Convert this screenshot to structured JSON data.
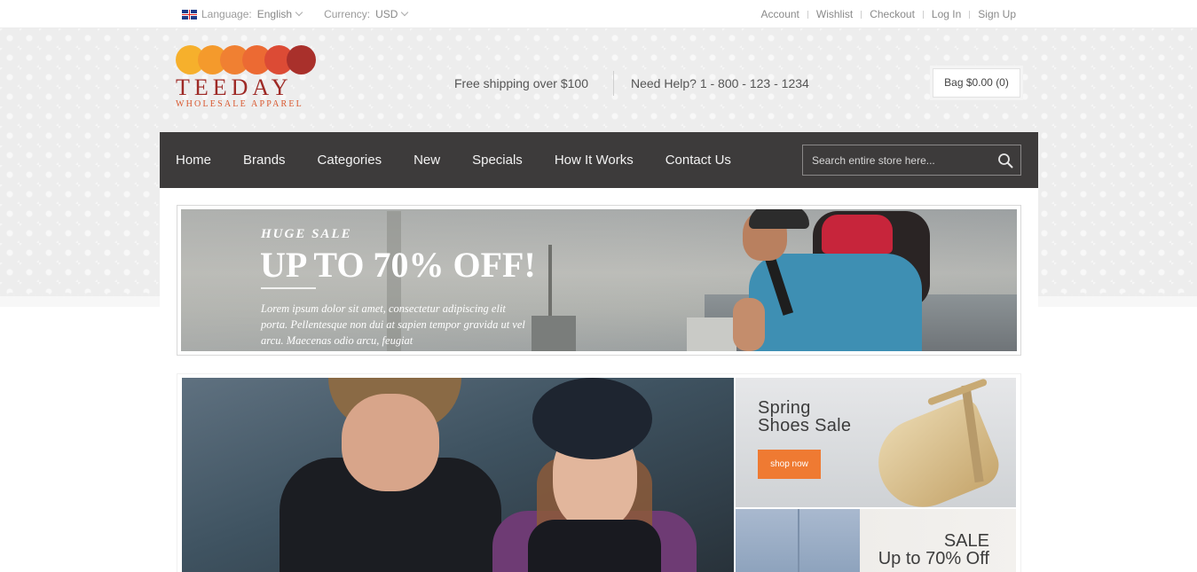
{
  "topbar": {
    "language_label": "Language:",
    "language_value": "English",
    "currency_label": "Currency:",
    "currency_value": "USD",
    "links": [
      "Account",
      "Wishlist",
      "Checkout",
      "Log In",
      "Sign Up"
    ]
  },
  "header": {
    "logo_name": "TEEDAY",
    "logo_tagline": "WHOLESALE APPAREL",
    "logo_colors": [
      "#f6b02c",
      "#f49a2c",
      "#f08032",
      "#ec6a33",
      "#dc4b35",
      "#a9302b"
    ],
    "shipping_text": "Free shipping over $100",
    "help_text": "Need Help? 1 - 800 - 123 - 1234",
    "bag_label": "Bag $0.00 (0)"
  },
  "nav": {
    "items": [
      "Home",
      "Brands",
      "Categories",
      "New",
      "Specials",
      "How It Works",
      "Contact Us"
    ],
    "search_placeholder": "Search entire store here..."
  },
  "hero": {
    "kicker": "HUGE SALE",
    "title": "UP TO 70% OFF!",
    "body": "Lorem ipsum dolor sit amet, consectetur adipiscing elit porta. Pellentesque non dui at sapien tempor gravida ut vel arcu. Maecenas odio arcu, feugiat"
  },
  "promos": {
    "shoes_line1": "Spring",
    "shoes_line2": "Shoes Sale",
    "shoes_button": "shop now",
    "sale_line1": "SALE",
    "sale_line2": "Up to 70% Off"
  },
  "colors": {
    "nav_bg": "#3d3b3b",
    "accent_orange": "#ef7a32",
    "brand_red": "#9e2a26"
  }
}
